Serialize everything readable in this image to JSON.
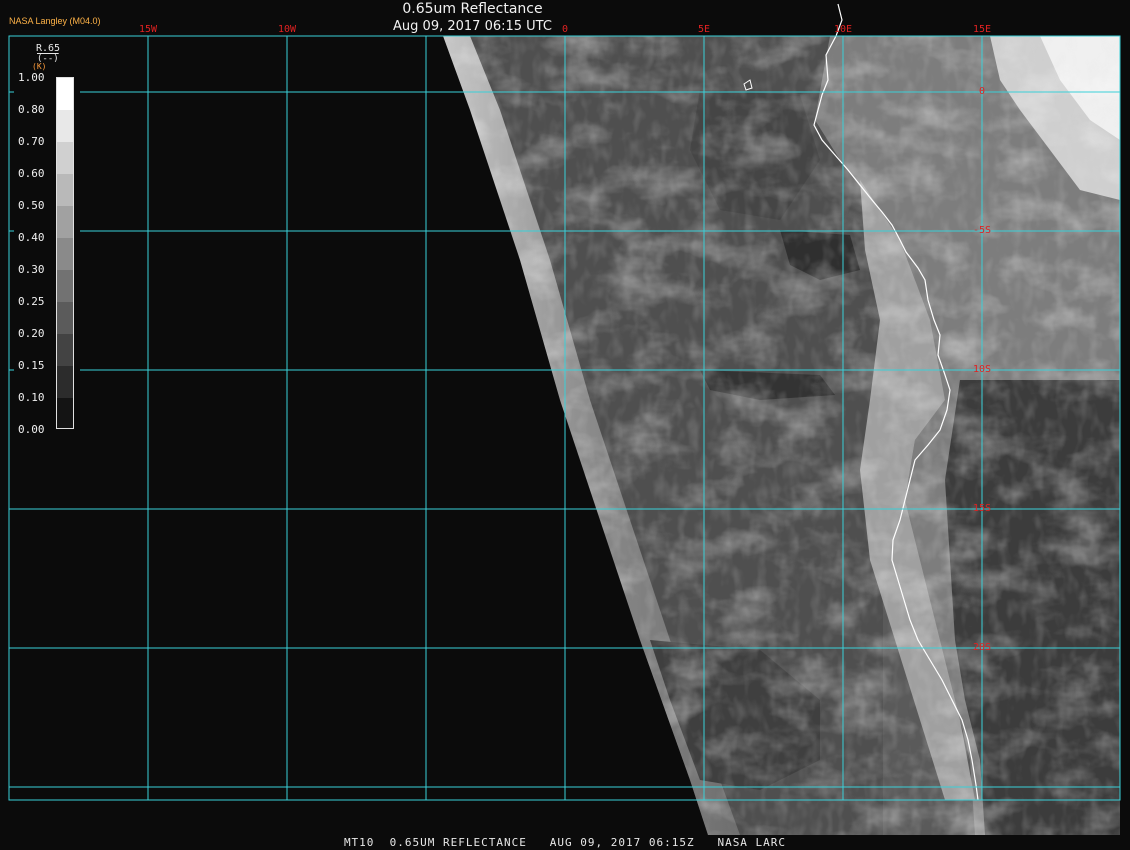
{
  "header": {
    "title": "0.65um Reflectance",
    "subtitle": "Aug 09, 2017 06:15 UTC",
    "source": "NASA Langley (M04.0)"
  },
  "footer": {
    "text": "MT10  0.65UM REFLECTANCE   AUG 09, 2017 06:15Z   NASA LARC"
  },
  "colorbar": {
    "variable": "R.65",
    "units": "(--)",
    "corner_mark": "(K)",
    "ticks": [
      "1.00",
      "0.80",
      "0.70",
      "0.60",
      "0.50",
      "0.40",
      "0.30",
      "0.25",
      "0.20",
      "0.15",
      "0.10",
      "0.00"
    ]
  },
  "grid": {
    "longitudes": [
      {
        "label": "15W",
        "value": -15
      },
      {
        "label": "10W",
        "value": -10
      },
      {
        "label": "0",
        "value": 0
      },
      {
        "label": "5E",
        "value": 5
      },
      {
        "label": "10E",
        "value": 10
      },
      {
        "label": "15E",
        "value": 15
      }
    ],
    "latitudes": [
      {
        "label": "0",
        "value": 0
      },
      {
        "label": "-5S",
        "value": -5
      },
      {
        "label": "10S",
        "value": -10
      },
      {
        "label": "15S",
        "value": -15
      },
      {
        "label": "20S",
        "value": -20
      }
    ]
  },
  "colors": {
    "grid_line": "#3ad0d8",
    "grid_label": "#e02222",
    "coastline": "#ffffff",
    "background": "#0b0b0b",
    "source_label": "#ffb347"
  }
}
